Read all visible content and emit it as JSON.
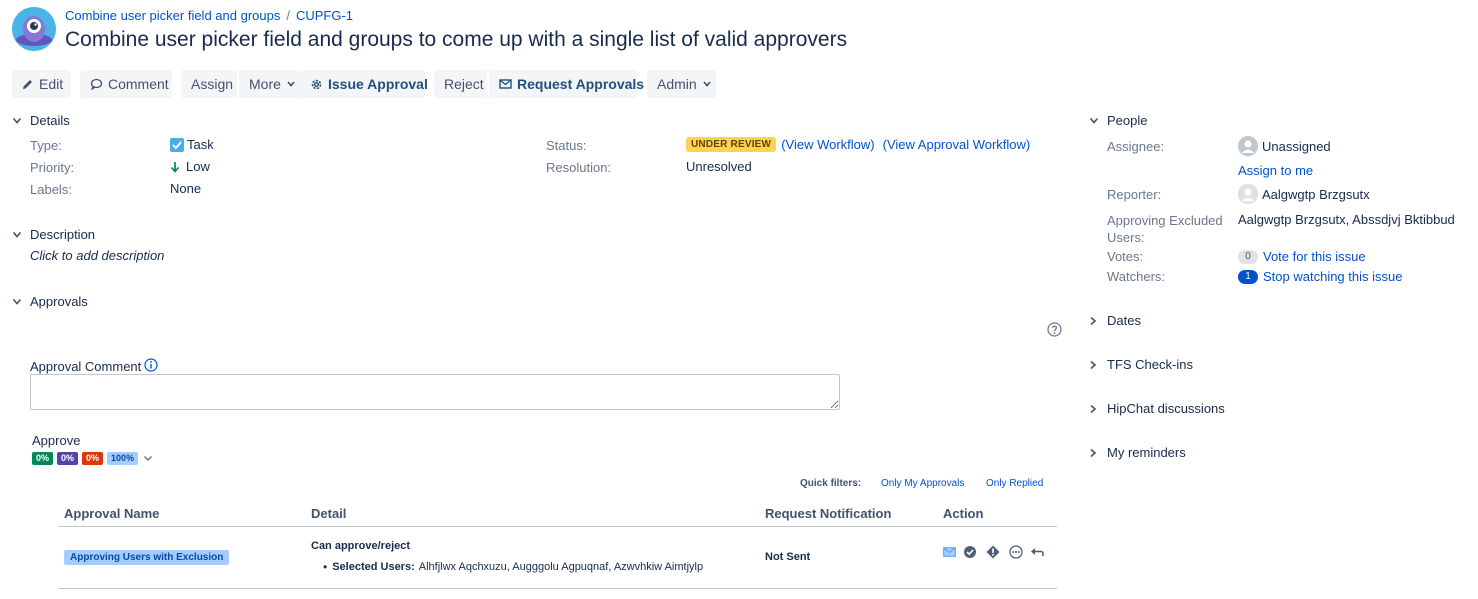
{
  "breadcrumb": {
    "project": "Combine user picker field and groups",
    "separator": "/",
    "issue_key": "CUPFG-1"
  },
  "summary": "Combine user picker field and groups to come up with a single list of valid approvers",
  "toolbar": {
    "edit": "Edit",
    "comment": "Comment",
    "assign": "Assign",
    "more": "More",
    "issue_approval": "Issue Approval",
    "reject": "Reject",
    "request_approvals": "Request Approvals",
    "admin": "Admin"
  },
  "details": {
    "heading": "Details",
    "type_label": "Type:",
    "type_value": "Task",
    "priority_label": "Priority:",
    "priority_value": "Low",
    "labels_label": "Labels:",
    "labels_value": "None",
    "status_label": "Status:",
    "status_value": "UNDER REVIEW",
    "view_workflow": "(View Workflow)",
    "view_approval_workflow": "(View Approval Workflow)",
    "resolution_label": "Resolution:",
    "resolution_value": "Unresolved"
  },
  "description": {
    "heading": "Description",
    "placeholder": "Click to add description"
  },
  "approvals": {
    "heading": "Approvals",
    "comment_label": "Approval Comment",
    "approve_label": "Approve",
    "pills": [
      "0%",
      "0%",
      "0%",
      "100%"
    ],
    "quick_filters_label": "Quick filters:",
    "filter_mine": "Only My Approvals",
    "filter_replied": "Only Replied",
    "columns": [
      "Approval Name",
      "Detail",
      "Request Notification",
      "Action"
    ],
    "row": {
      "name": "Approving Users with Exclusion",
      "detail_title": "Can approve/reject",
      "selected_users_label": "Selected Users:",
      "selected_users": "Alhfjlwx Aqchxuzu, Augggolu Agpuqnaf, Azwvhkiw Aimtjylp",
      "notification": "Not Sent"
    }
  },
  "people": {
    "heading": "People",
    "assignee_label": "Assignee:",
    "assignee_value": "Unassigned",
    "assign_to_me": "Assign to me",
    "reporter_label": "Reporter:",
    "reporter_value": "Aalgwgtp Brzgsutx",
    "excluded_label_1": "Approving Excluded",
    "excluded_label_2": "Users:",
    "excluded_value": "Aalgwgtp Brzgsutx, Abssdjvj Bktibbud",
    "votes_label": "Votes:",
    "votes_count": "0",
    "vote_link": "Vote for this issue",
    "watchers_label": "Watchers:",
    "watchers_count": "1",
    "watch_link": "Stop watching this issue"
  },
  "side_modules": [
    "Dates",
    "TFS Check-ins",
    "HipChat discussions",
    "My reminders"
  ],
  "colors": {
    "link": "#0052cc",
    "lozenge": "#ffd351",
    "pill_green": "#00875a",
    "pill_purple": "#5243aa",
    "pill_red": "#de350b",
    "pill_blue": "#a4cdff"
  }
}
